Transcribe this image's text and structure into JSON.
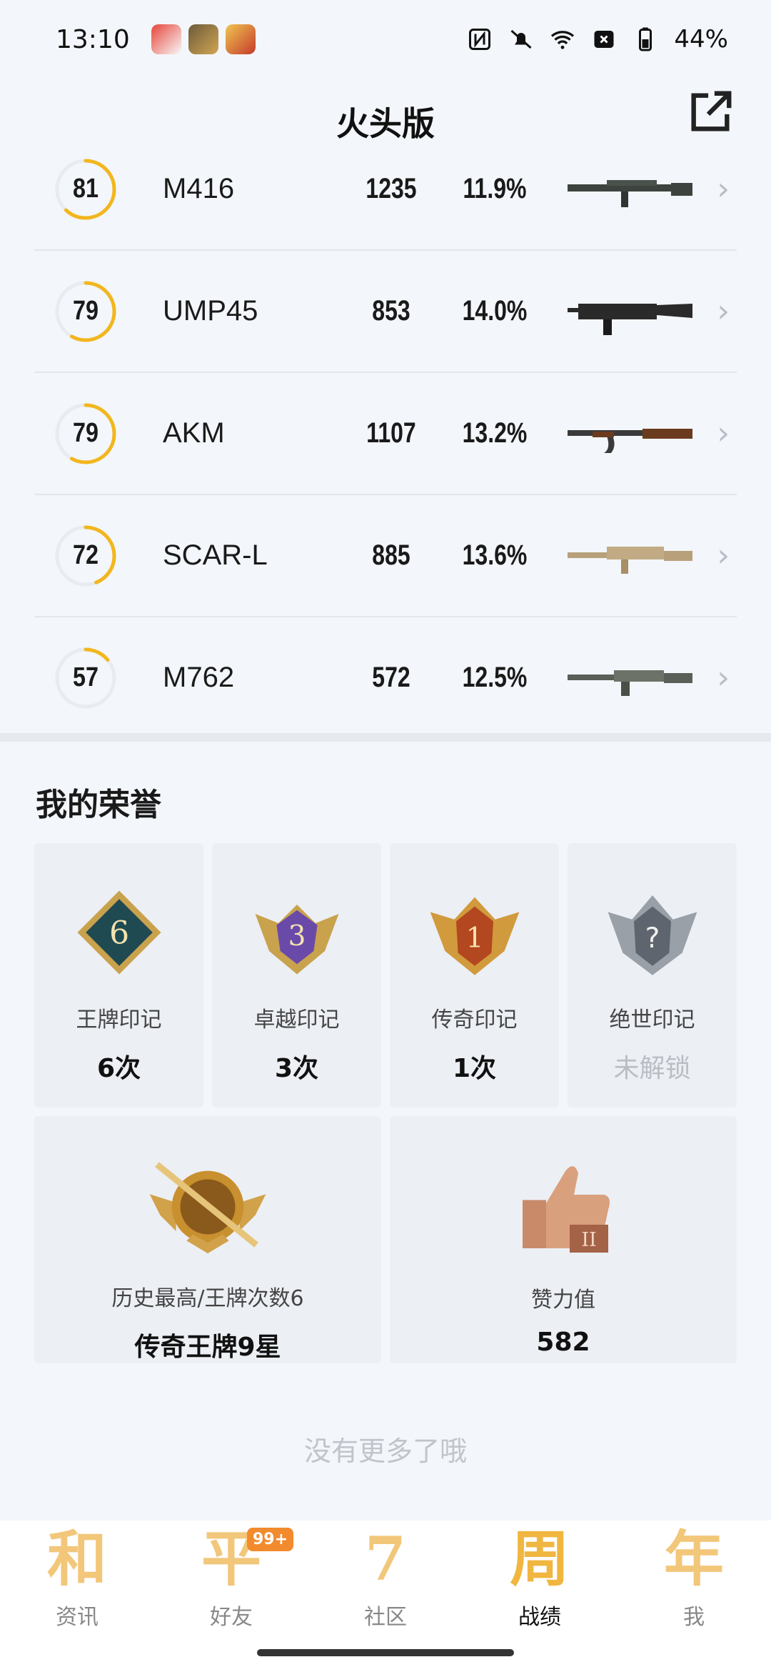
{
  "status_bar": {
    "time": "13:10",
    "battery": "44%",
    "icons": [
      "nfc-icon",
      "mute-icon",
      "wifi-icon",
      "close-box-icon",
      "battery-icon"
    ]
  },
  "header": {
    "title": "火头版",
    "share_icon": "share-icon"
  },
  "weapons": [
    {
      "score": "81",
      "score_value": 81,
      "name": "M416",
      "count": "1235",
      "rate": "11.9%"
    },
    {
      "score": "79",
      "score_value": 79,
      "name": "UMP45",
      "count": "853",
      "rate": "14.0%"
    },
    {
      "score": "79",
      "score_value": 79,
      "name": "AKM",
      "count": "1107",
      "rate": "13.2%"
    },
    {
      "score": "72",
      "score_value": 72,
      "name": "SCAR-L",
      "count": "885",
      "rate": "13.6%"
    },
    {
      "score": "57",
      "score_value": 57,
      "name": "M762",
      "count": "572",
      "rate": "12.5%"
    }
  ],
  "honors": {
    "title": "我的荣誉",
    "cards": [
      {
        "label": "王牌印记",
        "value": "6次",
        "badge_text": "6"
      },
      {
        "label": "卓越印记",
        "value": "3次",
        "badge_text": "3"
      },
      {
        "label": "传奇印记",
        "value": "1次",
        "badge_text": "1"
      },
      {
        "label": "绝世印记",
        "value": "未解锁",
        "badge_text": "?"
      }
    ],
    "wide_cards": [
      {
        "label": "历史最高/王牌次数6",
        "value": "传奇王牌9星"
      },
      {
        "label": "赞力值",
        "value": "582"
      }
    ]
  },
  "footer_text": "没有更多了哦",
  "nav": [
    {
      "glyph": "和",
      "label": "资讯"
    },
    {
      "glyph": "平",
      "label": "好友",
      "badge": "99+"
    },
    {
      "glyph": "7",
      "label": "社区"
    },
    {
      "glyph": "周",
      "label": "战绩"
    },
    {
      "glyph": "年",
      "label": "我"
    }
  ],
  "colors": {
    "accent": "#f2b61e",
    "ring_track": "#e8ebef",
    "background": "#f3f6fa"
  }
}
